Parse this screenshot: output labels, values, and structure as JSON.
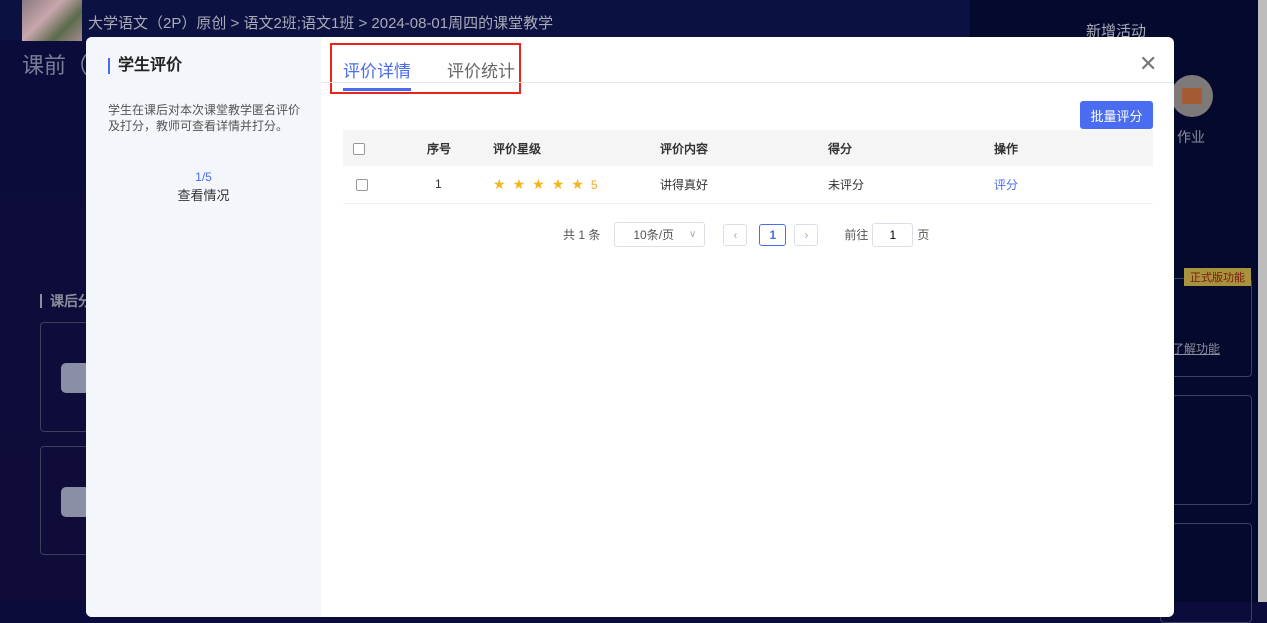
{
  "background": {
    "breadcrumb": "大学语文（2P）原创 > 语文2班;语文1班 > 2024-08-01周四的课堂教学",
    "section_before": "课前（",
    "new_activity": "新增活动",
    "homework_label": "作业",
    "badge": "正式版功能",
    "learn_more": "了解功能",
    "after_class": "课后分"
  },
  "modal": {
    "sidebar": {
      "title": "学生评价",
      "description": "学生在课后对本次课堂教学匿名评价及打分，教师可查看详情并打分。",
      "count": "1/5",
      "view": "查看情况"
    },
    "tabs": [
      {
        "label": "评价详情",
        "active": true
      },
      {
        "label": "评价统计",
        "active": false
      }
    ],
    "batch_button": "批量评分",
    "table": {
      "headers": [
        "序号",
        "评价星级",
        "评价内容",
        "得分",
        "操作"
      ],
      "rows": [
        {
          "index": "1",
          "stars": 5,
          "rating": "5",
          "content": "讲得真好",
          "score": "未评分",
          "action": "评分"
        }
      ]
    },
    "pagination": {
      "total": "共 1 条",
      "page_size": "10条/页",
      "current": "1",
      "goto_label": "前往",
      "goto_value": "1",
      "page_suffix": "页"
    }
  },
  "colors": {
    "accent": "#4a6cf0",
    "star": "#f5b51b",
    "highlight_box": "#e8241c"
  }
}
